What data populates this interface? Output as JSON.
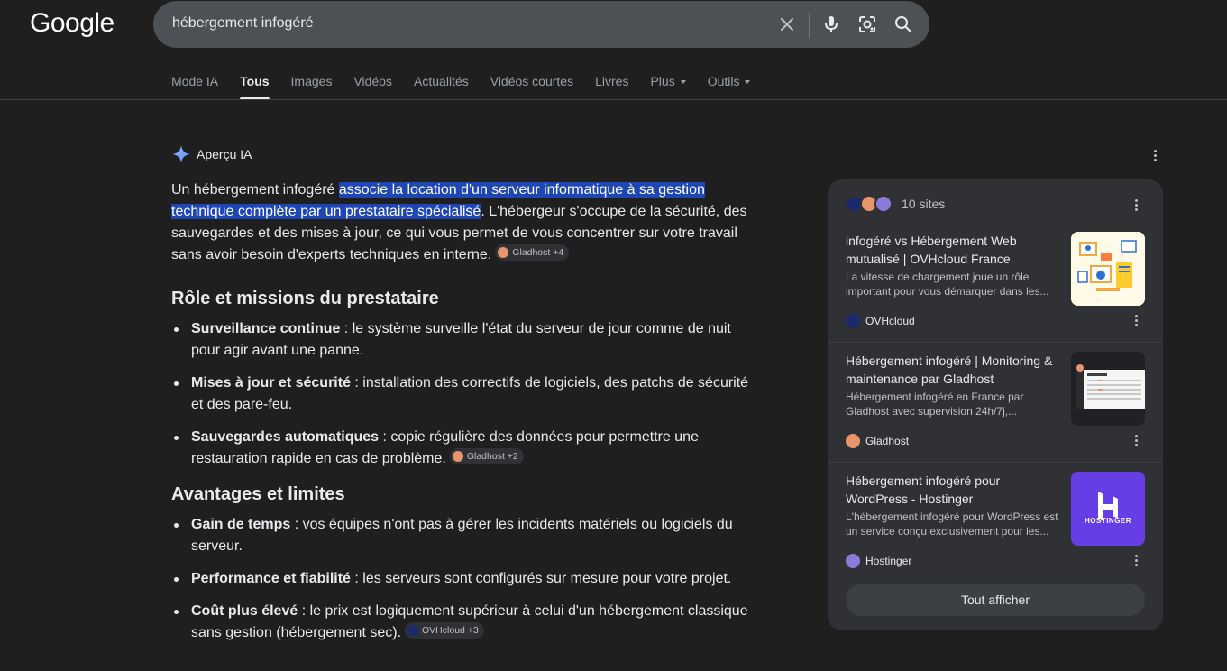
{
  "header": {
    "logo": "Google",
    "search_query": "hébergement infogéré"
  },
  "tabs": [
    {
      "label": "Mode IA"
    },
    {
      "label": "Tous"
    },
    {
      "label": "Images"
    },
    {
      "label": "Vidéos"
    },
    {
      "label": "Actualités"
    },
    {
      "label": "Vidéos courtes"
    },
    {
      "label": "Livres"
    },
    {
      "label": "Plus"
    },
    {
      "label": "Outils"
    }
  ],
  "ai_overview": {
    "title": "Aperçu IA",
    "intro_pre": "Un hébergement infogéré ",
    "intro_highlight": "associe la location d'un serveur informatique à sa gestion technique complète par un prestataire spécialisé",
    "intro_post": ". L'hébergeur s'occupe de la sécurité, des sauvegardes et des mises à jour, ce qui vous permet de vous concentrer sur votre travail sans avoir besoin d'experts techniques en interne.",
    "intro_chip": "Gladhost +4",
    "section1": {
      "heading": "Rôle et missions du prestataire",
      "items": [
        {
          "bold": "Surveillance continue",
          "text": " : le système surveille l'état du serveur de jour comme de nuit pour agir avant une panne."
        },
        {
          "bold": "Mises à jour et sécurité",
          "text": " : installation des correctifs de logiciels, des patchs de sécurité et des pare-feu."
        },
        {
          "bold": "Sauvegardes automatiques",
          "text": " : copie régulière des données pour permettre une restauration rapide en cas de problème.",
          "chip": "Gladhost +2"
        }
      ]
    },
    "section2": {
      "heading": "Avantages et limites",
      "items": [
        {
          "bold": "Gain de temps",
          "text": " : vos équipes n'ont pas à gérer les incidents matériels ou logiciels du serveur."
        },
        {
          "bold": "Performance et fiabilité",
          "text": " : les serveurs sont configurés sur mesure pour votre projet."
        },
        {
          "bold": "Coût plus élevé",
          "text": " : le prix est logiquement supérieur à celui d'un hébergement classique sans gestion (hébergement sec).",
          "chip": "OVHcloud +3"
        }
      ]
    }
  },
  "sources_card": {
    "count_label": "10 sites",
    "items": [
      {
        "title": "infogéré vs Hébergement Web mutualisé | OVHcloud France",
        "desc": "La vitesse de chargement joue un rôle important pour vous démarquer dans les...",
        "site": "OVHcloud"
      },
      {
        "title": "Hébergement infogéré | Monitoring & maintenance par Gladhost",
        "desc": "Hébergement infogéré en France par Gladhost avec supervision 24h/7j,...",
        "site": "Gladhost"
      },
      {
        "title": "Hébergement infogéré pour WordPress - Hostinger",
        "desc": "L'hébergement infogéré pour WordPress est un service conçu exclusivement pour les...",
        "site": "Hostinger",
        "thumb_text": "HOSTINGER"
      }
    ],
    "show_all": "Tout afficher"
  },
  "colors": {
    "background": "#1f1f1f",
    "highlight": "#1e47b5",
    "card": "#303134",
    "hostinger": "#673de6"
  }
}
